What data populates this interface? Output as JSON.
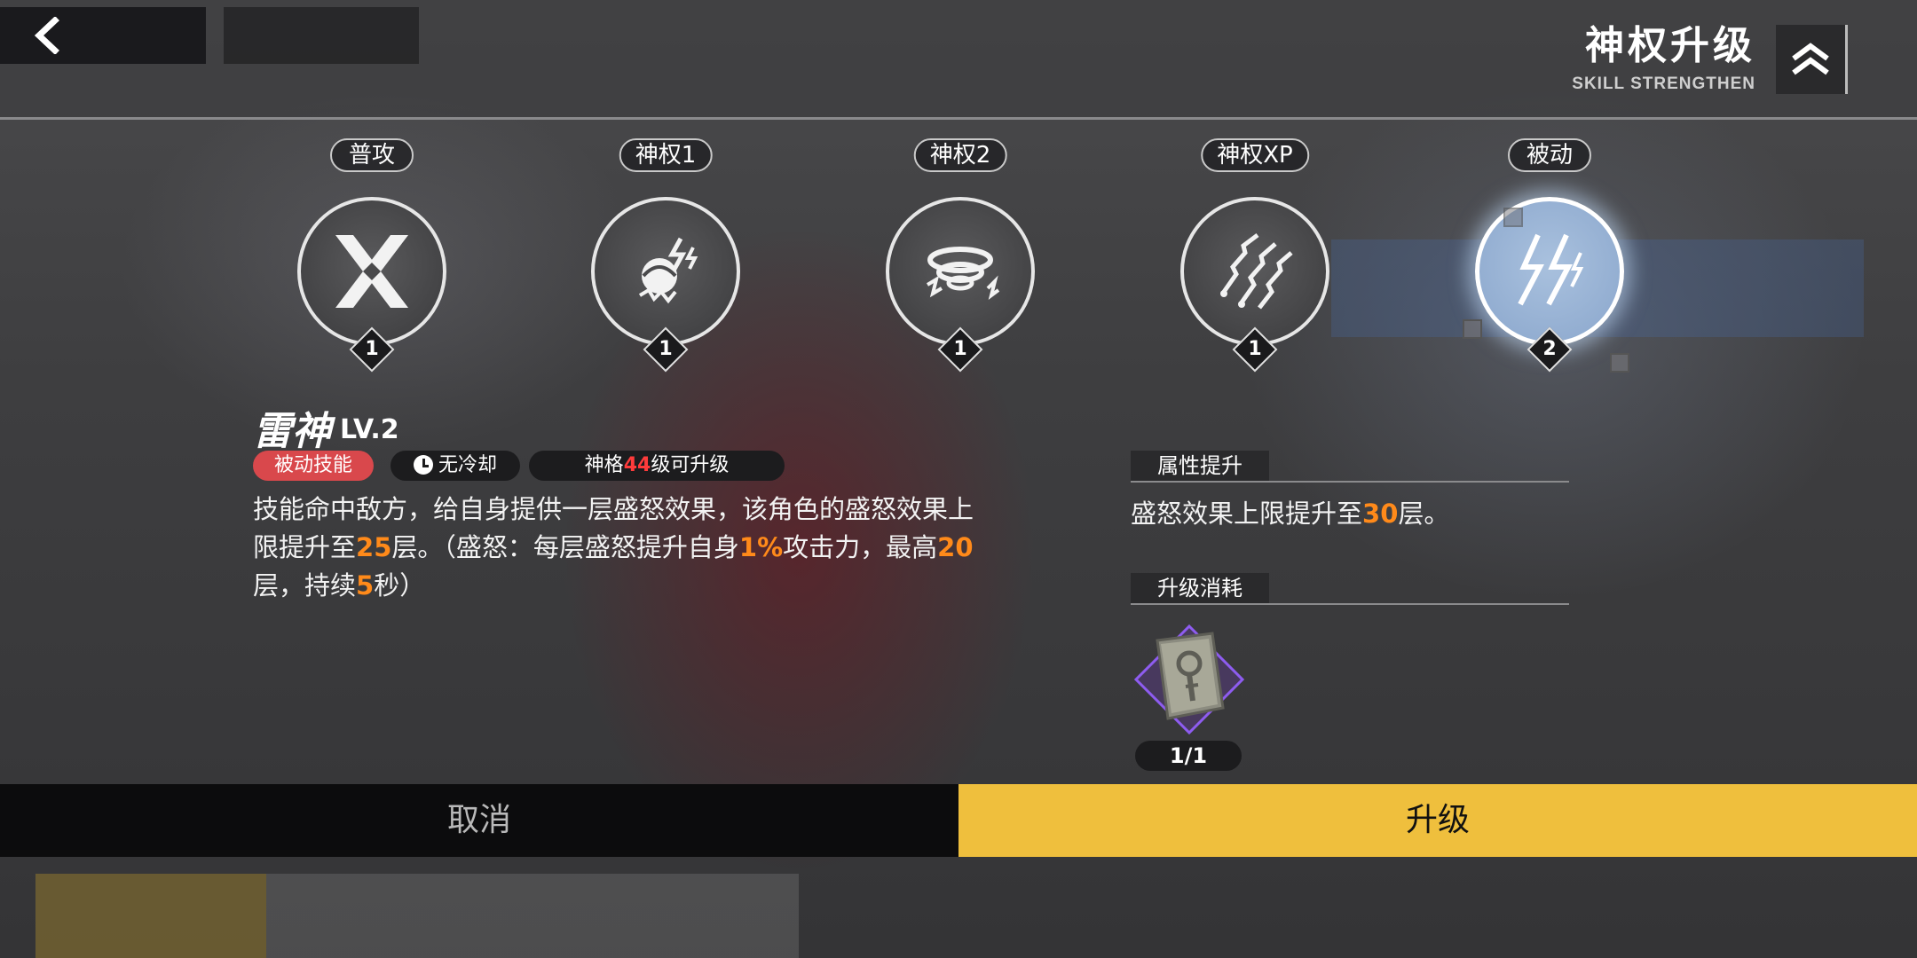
{
  "header": {
    "title": "神权升级",
    "subtitle": "SKILL STRENGTHEN"
  },
  "skills": [
    {
      "tab": "普攻",
      "level": "1",
      "icon": "crossed-blades-icon"
    },
    {
      "tab": "神权1",
      "level": "1",
      "icon": "lightning-fist-icon"
    },
    {
      "tab": "神权2",
      "level": "1",
      "icon": "storm-vortex-icon"
    },
    {
      "tab": "神权XP",
      "level": "1",
      "icon": "lightning-chains-icon"
    },
    {
      "tab": "被动",
      "level": "2",
      "icon": "lightning-bolt-icon",
      "selected": true
    }
  ],
  "detail": {
    "name": "雷神",
    "level": "LV.2",
    "tag_type": "被动技能",
    "tag_cooldown": "无冷却",
    "req_prefix": "神格",
    "req_value": "44",
    "req_suffix": "级可升级",
    "desc_1": "技能命中敌方，给自身提供一层盛怒效果，该角色的盛怒效果上限提升至",
    "desc_v1": "25",
    "desc_2": "层。（盛怒：每层盛怒提升自身",
    "desc_v2": "1%",
    "desc_3": "攻击力，最高",
    "desc_v3": "20",
    "desc_4": "层，持续",
    "desc_v4": "5",
    "desc_5": "秒）"
  },
  "attribute": {
    "heading": "属性提升",
    "text_1": "盛怒效果上限提升至",
    "value": "30",
    "text_2": "层。"
  },
  "cost": {
    "heading": "升级消耗",
    "item_icon": "skill-book-icon",
    "count": "1/1"
  },
  "buttons": {
    "cancel": "取消",
    "upgrade": "升级"
  },
  "colors": {
    "upgrade_button": "#efbf3d",
    "passive_tag": "#d9484c",
    "highlight_orange": "#ff8a1a",
    "highlight_red": "#ff3b3b",
    "selected_skill": "#a9c1de"
  }
}
